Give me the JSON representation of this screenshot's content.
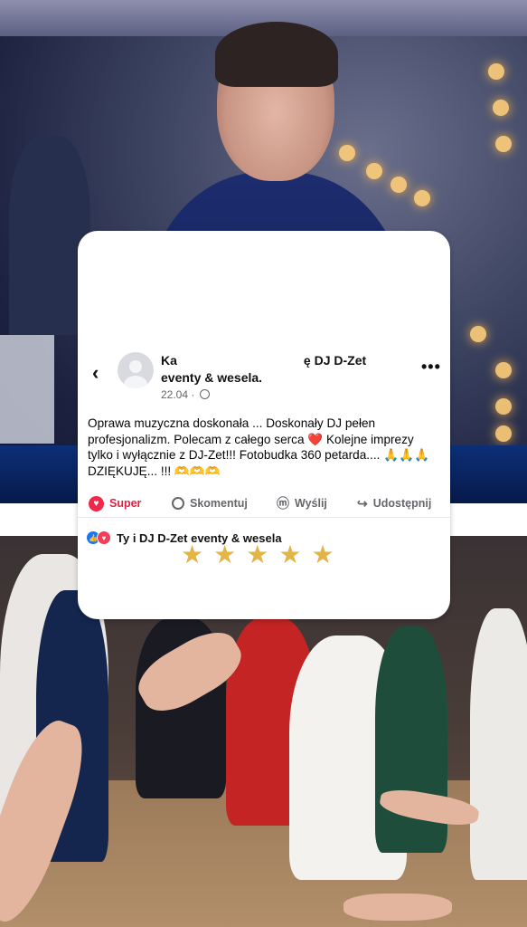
{
  "post": {
    "back_glyph": "‹",
    "author_prefix": "Ka",
    "author_suffix": "ę DJ D-Zet",
    "author_line2": "eventy & wesela.",
    "date": "22.04",
    "more_glyph": "•••",
    "body": "Oprawa muzyczna doskonała ... Doskonały DJ pełen profesjonalizm. Polecam z całego serca ❤️ Kolejne imprezy tylko i wyłącznie z DJ-Zet!!! Fotobudka 360 petarda.... 🙏🙏🙏 DZIĘKUJĘ... !!! 🫶🫶🫶"
  },
  "actions": [
    {
      "label": "Super",
      "icon": "heart-icon"
    },
    {
      "label": "Skomentuj",
      "icon": "comment-icon"
    },
    {
      "label": "Wyślij",
      "icon": "messenger-icon"
    },
    {
      "label": "Udostępnij",
      "icon": "share-icon"
    }
  ],
  "reactions": {
    "text": "Ty i DJ D-Zet eventy & wesela",
    "icons": [
      "like-icon",
      "love-icon"
    ]
  },
  "rating": {
    "stars": 5,
    "max": 5,
    "star_glyph": "★",
    "color": "#e2b548"
  },
  "colors": {
    "accent_blue": "#1877f2",
    "super_red": "#e41e3f"
  }
}
